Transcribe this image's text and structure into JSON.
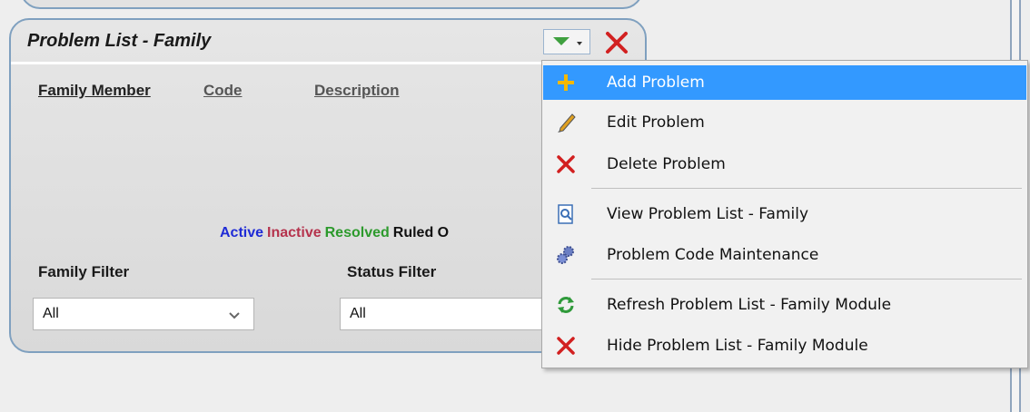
{
  "panel": {
    "title": "Problem List - Family",
    "columns": [
      "Family Member",
      "Code",
      "Description"
    ],
    "legend": [
      {
        "label": "Active",
        "color": "#1f2bd6"
      },
      {
        "label": "Inactive",
        "color": "#b5334d"
      },
      {
        "label": "Resolved",
        "color": "#2c9a2c"
      },
      {
        "label": "Ruled O",
        "color": "#111111"
      }
    ],
    "family_filter": {
      "label": "Family Filter",
      "value": "All"
    },
    "status_filter": {
      "label": "Status Filter",
      "value": "All"
    }
  },
  "menu": {
    "items": [
      {
        "label": "Add Problem",
        "icon": "plus-icon"
      },
      {
        "label": "Edit Problem",
        "icon": "pencil-icon"
      },
      {
        "label": "Delete Problem",
        "icon": "x-icon"
      },
      {
        "label": "View Problem List - Family",
        "icon": "document-view-icon"
      },
      {
        "label": "Problem Code Maintenance",
        "icon": "gears-icon"
      },
      {
        "label": "Refresh Problem List - Family Module",
        "icon": "refresh-icon"
      },
      {
        "label": "Hide Problem List - Family Module",
        "icon": "x-icon"
      }
    ],
    "highlight_color": "#3399ff"
  }
}
